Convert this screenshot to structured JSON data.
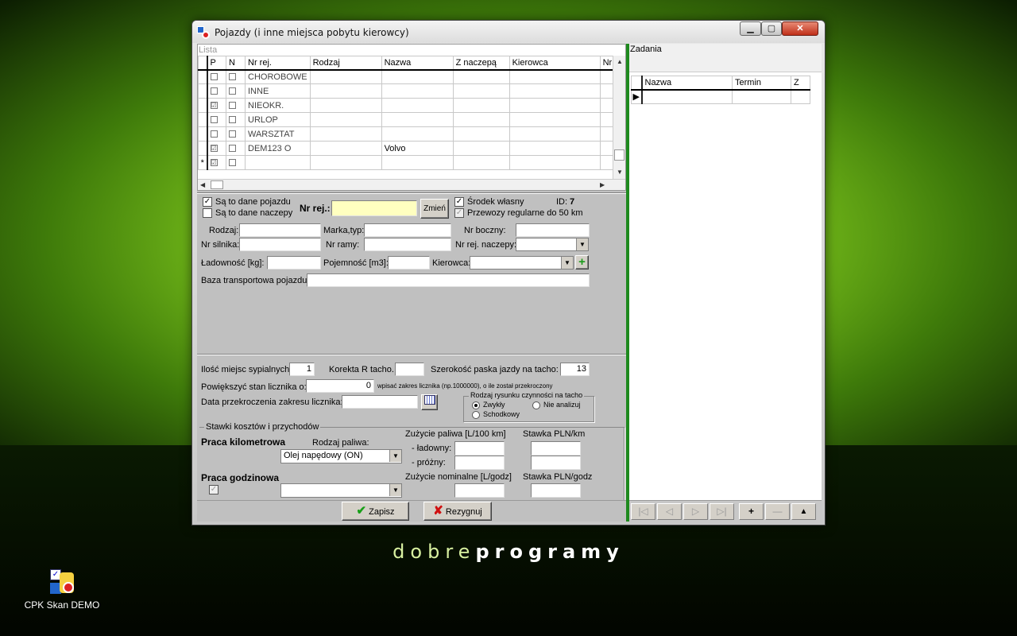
{
  "window": {
    "title": "Pojazdy (i inne miejsca pobytu kierowcy)"
  },
  "list": {
    "label": "Lista",
    "columns": [
      "P",
      "N",
      "Nr rej.",
      "Rodzaj",
      "Nazwa",
      "Z naczepą",
      "Kierowca",
      "Nr"
    ],
    "rows": [
      {
        "p": "",
        "n": "",
        "nr": "CHOROBOWE",
        "nazwa": ""
      },
      {
        "p": "",
        "n": "",
        "nr": "INNE",
        "nazwa": ""
      },
      {
        "p": "☑",
        "n": "",
        "nr": "NIEOKR.",
        "nazwa": ""
      },
      {
        "p": "",
        "n": "",
        "nr": "URLOP",
        "nazwa": ""
      },
      {
        "p": "",
        "n": "",
        "nr": "WARSZTAT",
        "nazwa": ""
      },
      {
        "p": "☑",
        "n": "",
        "nr": "DEM123 O",
        "nazwa": "Volvo"
      },
      {
        "p": "☑",
        "n": "",
        "nr": "",
        "nazwa": "",
        "marker": "*"
      }
    ]
  },
  "form": {
    "is_vehicle_label": "Są to dane pojazdu",
    "is_trailer_label": "Są to dane naczepy",
    "nr_rej_label": "Nr rej.:",
    "nr_rej_value": "",
    "change_btn": "Zmień",
    "own_label": "Środek własny",
    "regular_label": "Przewozy regularne do 50 km",
    "id_label": "ID:",
    "id_value": "7",
    "rodzaj": "Rodzaj:",
    "marka": "Marka,typ:",
    "nr_boczny": "Nr boczny:",
    "nr_silnika": "Nr silnika:",
    "nr_ramy": "Nr ramy:",
    "nr_rej_naczepy": "Nr rej. naczepy:",
    "ladownosc": "Ładowność [kg]:",
    "pojemnosc": "Pojemność [m3]:",
    "kierowca": "Kierowca:",
    "baza": "Baza transportowa pojazdu:"
  },
  "tacho": {
    "beds_label": "Ilość miejsc sypialnych",
    "beds_value": "1",
    "correction_label": "Korekta R tacho.",
    "correction_value": "",
    "width_label": "Szerokość paska jazdy na tacho:",
    "width_value": "13",
    "increase_label": "Powiększyć stan licznika o:",
    "increase_value": "0",
    "increase_hint": "wpisać zakres licznika (np.1000000), o ile został przekroczony",
    "date_label": "Data przekroczenia zakresu licznika:",
    "group_label": "Rodzaj rysunku czynności na tacho",
    "opt1": "Zwykły",
    "opt2": "Nie analizuj",
    "opt3": "Schodkowy"
  },
  "costs": {
    "group_label": "Stawki kosztów i przychodów",
    "km_work": "Praca kilometrowa",
    "fuel_type_label": "Rodzaj paliwa:",
    "fuel_type_value": "Olej napędowy (ON)",
    "fuel_usage": "Zużycie paliwa [L/100 km]",
    "rate_km": "Stawka PLN/km",
    "loaded": "- ładowny:",
    "empty": "- próżny:",
    "hour_work": "Praca godzinowa",
    "nominal": "Zużycie nominalne [L/godz]",
    "rate_h": "Stawka PLN/godz"
  },
  "buttons": {
    "save": "Zapisz",
    "cancel": "Rezygnuj"
  },
  "tasks": {
    "label": "Zadania",
    "columns": [
      "Nazwa",
      "Termin",
      "Z"
    ]
  },
  "desktop": {
    "watermark_light": "dobre",
    "watermark_bold": "programy",
    "icon_label": "CPK Skan DEMO"
  },
  "colors": {
    "accent": "#1e8a1e",
    "highlight_input": "#ffffc0"
  }
}
